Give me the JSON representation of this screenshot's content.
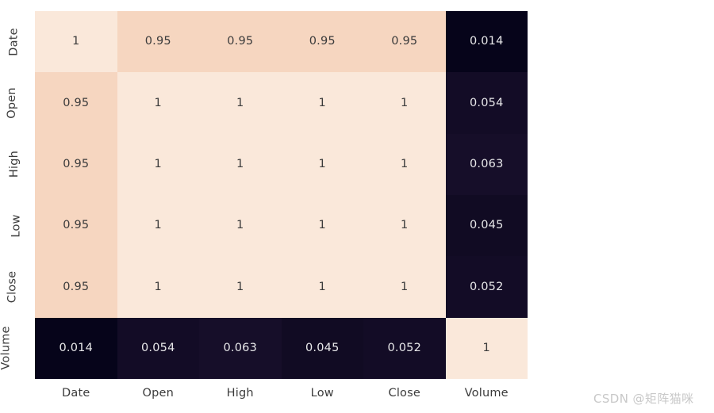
{
  "chart_data": {
    "type": "heatmap",
    "title": "",
    "subtitle": "",
    "xlabel": "",
    "ylabel": "",
    "categories": [
      "Date",
      "Open",
      "High",
      "Low",
      "Close",
      "Volume"
    ],
    "x_tick_labels": [
      "Date",
      "Open",
      "High",
      "Low",
      "Close",
      "Volume"
    ],
    "y_tick_labels": [
      "Date",
      "Open",
      "High",
      "Low",
      "Close",
      "Volume"
    ],
    "annotated": true,
    "grid": false,
    "legend": "none",
    "colorbar": false,
    "colormap": "rocket_r",
    "vmin": 0,
    "vmax": 1,
    "rows": [
      {
        "label": "Date",
        "cells": [
          {
            "display": "1",
            "value": 1,
            "fill": "#fae8da",
            "text": "#3b3b3b"
          },
          {
            "display": "0.95",
            "value": 0.95,
            "fill": "#f6d6c0",
            "text": "#3b3b3b"
          },
          {
            "display": "0.95",
            "value": 0.95,
            "fill": "#f6d6c0",
            "text": "#3b3b3b"
          },
          {
            "display": "0.95",
            "value": 0.95,
            "fill": "#f6d6c0",
            "text": "#3b3b3b"
          },
          {
            "display": "0.95",
            "value": 0.95,
            "fill": "#f6d6c0",
            "text": "#3b3b3b"
          },
          {
            "display": "0.014",
            "value": 0.014,
            "fill": "#06041a",
            "text": "#e8e8ea"
          }
        ]
      },
      {
        "label": "Open",
        "cells": [
          {
            "display": "0.95",
            "value": 0.95,
            "fill": "#f6d6c0",
            "text": "#3b3b3b"
          },
          {
            "display": "1",
            "value": 1,
            "fill": "#fae8da",
            "text": "#3b3b3b"
          },
          {
            "display": "1",
            "value": 1,
            "fill": "#fae8da",
            "text": "#3b3b3b"
          },
          {
            "display": "1",
            "value": 1,
            "fill": "#fae8da",
            "text": "#3b3b3b"
          },
          {
            "display": "1",
            "value": 1,
            "fill": "#fae8da",
            "text": "#3b3b3b"
          },
          {
            "display": "0.054",
            "value": 0.054,
            "fill": "#130c26",
            "text": "#e8e8ea"
          }
        ]
      },
      {
        "label": "High",
        "cells": [
          {
            "display": "0.95",
            "value": 0.95,
            "fill": "#f6d6c0",
            "text": "#3b3b3b"
          },
          {
            "display": "1",
            "value": 1,
            "fill": "#fae8da",
            "text": "#3b3b3b"
          },
          {
            "display": "1",
            "value": 1,
            "fill": "#fae8da",
            "text": "#3b3b3b"
          },
          {
            "display": "1",
            "value": 1,
            "fill": "#fae8da",
            "text": "#3b3b3b"
          },
          {
            "display": "1",
            "value": 1,
            "fill": "#fae8da",
            "text": "#3b3b3b"
          },
          {
            "display": "0.063",
            "value": 0.063,
            "fill": "#160e29",
            "text": "#e8e8ea"
          }
        ]
      },
      {
        "label": "Low",
        "cells": [
          {
            "display": "0.95",
            "value": 0.95,
            "fill": "#f6d6c0",
            "text": "#3b3b3b"
          },
          {
            "display": "1",
            "value": 1,
            "fill": "#fae8da",
            "text": "#3b3b3b"
          },
          {
            "display": "1",
            "value": 1,
            "fill": "#fae8da",
            "text": "#3b3b3b"
          },
          {
            "display": "1",
            "value": 1,
            "fill": "#fae8da",
            "text": "#3b3b3b"
          },
          {
            "display": "1",
            "value": 1,
            "fill": "#fae8da",
            "text": "#3b3b3b"
          },
          {
            "display": "0.045",
            "value": 0.045,
            "fill": "#110b23",
            "text": "#e8e8ea"
          }
        ]
      },
      {
        "label": "Close",
        "cells": [
          {
            "display": "0.95",
            "value": 0.95,
            "fill": "#f6d6c0",
            "text": "#3b3b3b"
          },
          {
            "display": "1",
            "value": 1,
            "fill": "#fae8da",
            "text": "#3b3b3b"
          },
          {
            "display": "1",
            "value": 1,
            "fill": "#fae8da",
            "text": "#3b3b3b"
          },
          {
            "display": "1",
            "value": 1,
            "fill": "#fae8da",
            "text": "#3b3b3b"
          },
          {
            "display": "1",
            "value": 1,
            "fill": "#fae8da",
            "text": "#3b3b3b"
          },
          {
            "display": "0.052",
            "value": 0.052,
            "fill": "#130c26",
            "text": "#e8e8ea"
          }
        ]
      },
      {
        "label": "Volume",
        "cells": [
          {
            "display": "0.014",
            "value": 0.014,
            "fill": "#06041a",
            "text": "#e8e8ea"
          },
          {
            "display": "0.054",
            "value": 0.054,
            "fill": "#130c26",
            "text": "#e8e8ea"
          },
          {
            "display": "0.063",
            "value": 0.063,
            "fill": "#160e29",
            "text": "#e8e8ea"
          },
          {
            "display": "0.045",
            "value": 0.045,
            "fill": "#110b23",
            "text": "#e8e8ea"
          },
          {
            "display": "0.052",
            "value": 0.052,
            "fill": "#130c26",
            "text": "#e8e8ea"
          },
          {
            "display": "1",
            "value": 1,
            "fill": "#fae8da",
            "text": "#3b3b3b"
          }
        ]
      }
    ],
    "matrix": [
      [
        1,
        0.95,
        0.95,
        0.95,
        0.95,
        0.014
      ],
      [
        0.95,
        1,
        1,
        1,
        1,
        0.054
      ],
      [
        0.95,
        1,
        1,
        1,
        1,
        0.063
      ],
      [
        0.95,
        1,
        1,
        1,
        1,
        0.045
      ],
      [
        0.95,
        1,
        1,
        1,
        1,
        0.052
      ],
      [
        0.014,
        0.054,
        0.063,
        0.045,
        0.052,
        1
      ]
    ]
  },
  "watermark": {
    "text": "CSDN @矩阵猫咪",
    "color": "#c8c8c8"
  },
  "figure": {
    "background": "#ffffff",
    "tick_label_color": "#3b3b3b"
  }
}
